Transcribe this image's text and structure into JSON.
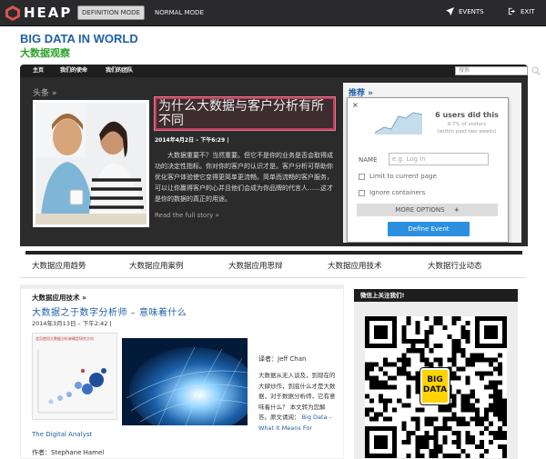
{
  "heap_toolbar": {
    "brand": "HEAP",
    "definition_mode": "DEFINITION MODE",
    "normal_mode": "NORMAL MODE",
    "events": "EVENTS",
    "exit": "EXIT"
  },
  "site": {
    "title": "BIG DATA IN WORLD",
    "subtitle": "大数据观察"
  },
  "nav": {
    "items": [
      "主页",
      "我们的使命",
      "我们的团队"
    ],
    "search_placeholder": "搜索"
  },
  "headline": {
    "label": "头条 »",
    "title": "为什么大数据与客户分析有所不同",
    "date": "2014年4月2日 – 下午6:29 |",
    "body": "大数据重要不？当然重要。但它不是你的业务是否会取得成功的决定性指标。你对你的客户的认识才是。客户分析可帮助你优化客户体验使它变得更简单更流畅。简单而流畅的客户服务，可以让你赢得客户的心并且他们会成为你品牌的代言人……这才是你的数据的真正的用途。",
    "more": "Read the full story »"
  },
  "recommend": {
    "label": "推荐 »"
  },
  "heap_popup": {
    "close": "×",
    "users": "6 users did this",
    "percent": "9.7% of visitors",
    "window": "(within past two weeks)",
    "name_label": "NAME",
    "name_placeholder": "e.g. Log In",
    "limit_label": "Limit to current page",
    "ignore_label": "Ignore containers",
    "more_options": "MORE OPTIONS",
    "plus": "+",
    "define_button": "Define Event",
    "colors": {
      "primary": "#2b8fe0",
      "outline": "#c33c5a"
    }
  },
  "categories": [
    "大数据应用趋势",
    "大数据应用案例",
    "大数据应用思辩",
    "大数据应用技术",
    "大数据行业动态"
  ],
  "article": {
    "section": "大数据应用技术 »",
    "title": "大数据之于数字分析师 – 意味着什么",
    "date": "2014年3月13日 – 下午2:42 |",
    "thumb_caption": "会员使用大数据分析来确定研究方向",
    "translator": "译者：Jeff Chan",
    "body": "大数据从无入谈及，到现在的大肆炒作，到底什么才是大数据，对于数据分析师，它有意味着什么？ 本文转为您解答。原文请阅：",
    "link": "Big Data – What It Means For",
    "source": "The Digital Analyst",
    "author": "作者：Stephane Hamel"
  },
  "wechat": {
    "heading": "微信上关注我们!",
    "badge_line1": "BIG",
    "badge_line2": "DATA"
  }
}
